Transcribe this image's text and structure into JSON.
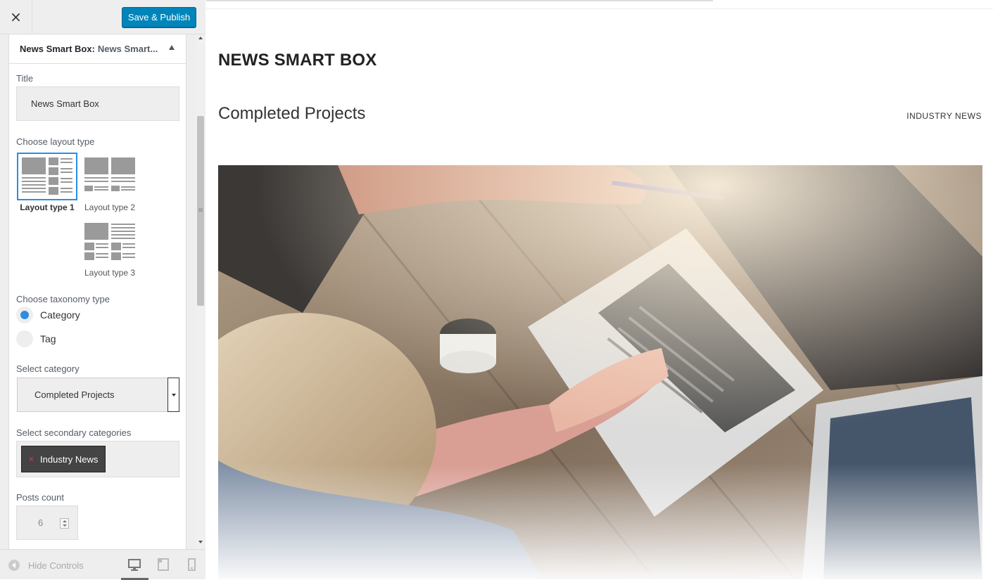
{
  "topbar": {
    "close_icon": "×",
    "save_label": "Save & Publish",
    "accent": "#0085ba"
  },
  "section": {
    "title_prefix": "News Smart Box:",
    "title_sub": "News Smart..."
  },
  "controls": {
    "title_label": "Title",
    "title_value": "News Smart Box",
    "layout_label": "Choose layout type",
    "layouts": [
      {
        "label": "Layout type 1",
        "selected": true
      },
      {
        "label": "Layout type 2",
        "selected": false
      },
      {
        "label": "Layout type 3",
        "selected": false
      }
    ],
    "taxonomy_label": "Choose taxonomy type",
    "taxonomy_options": [
      {
        "label": "Category",
        "checked": true
      },
      {
        "label": "Tag",
        "checked": false
      }
    ],
    "category_label": "Select category",
    "category_value": "Completed Projects",
    "secondary_label": "Select secondary categories",
    "secondary_selected": [
      {
        "label": "Industry News",
        "remove_icon": "×"
      }
    ],
    "posts_count_label": "Posts count",
    "posts_count_value": "6"
  },
  "footer": {
    "hide_controls_label": "Hide Controls",
    "devices": [
      "desktop-icon",
      "tablet-icon",
      "mobile-icon"
    ],
    "active_device": "desktop"
  },
  "preview": {
    "widget_title": "NEWS SMART BOX",
    "category_title": "Completed Projects",
    "secondary_link": "INDUSTRY NEWS"
  }
}
